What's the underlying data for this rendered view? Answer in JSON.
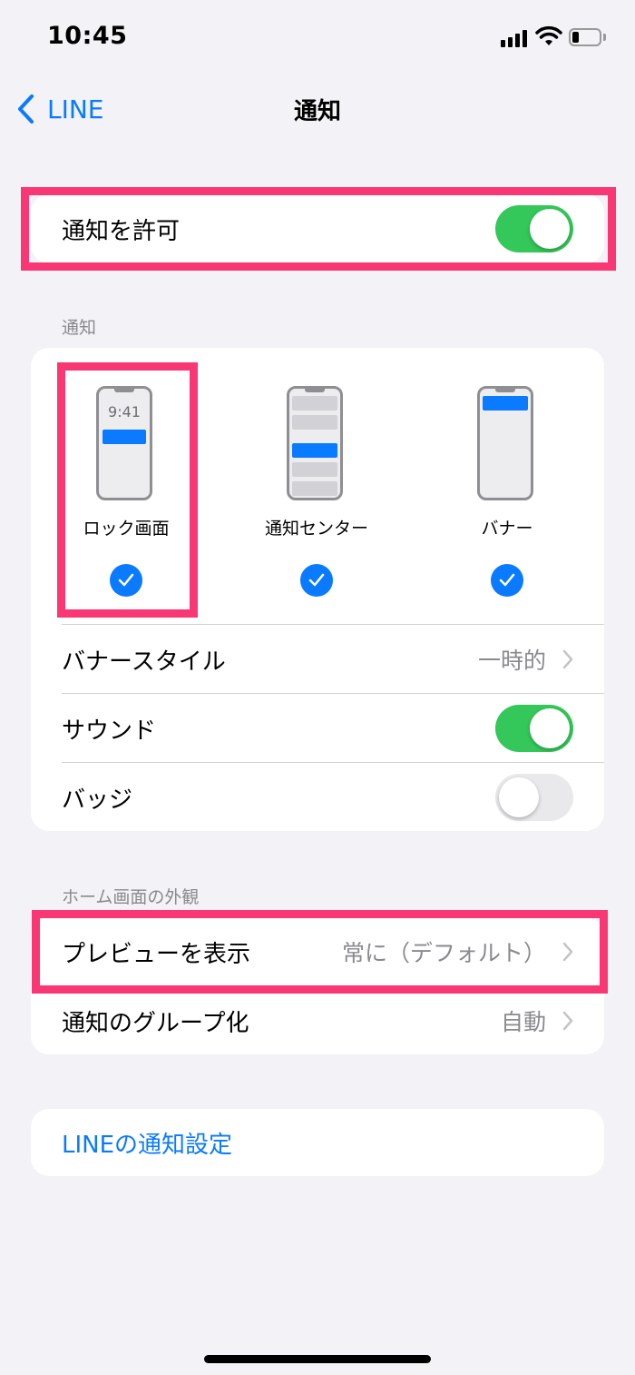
{
  "status_bar": {
    "time": "10:45"
  },
  "nav": {
    "back_label": "LINE",
    "title": "通知"
  },
  "allow": {
    "label": "通知を許可",
    "enabled": true
  },
  "notifications_section": {
    "header": "通知",
    "styles": [
      {
        "label": "ロック画面",
        "preview_time": "9:41",
        "checked": true
      },
      {
        "label": "通知センター",
        "checked": true
      },
      {
        "label": "バナー",
        "checked": true
      }
    ],
    "banner_style": {
      "label": "バナースタイル",
      "value": "一時的"
    },
    "sound": {
      "label": "サウンド",
      "enabled": true
    },
    "badges": {
      "label": "バッジ",
      "enabled": false
    }
  },
  "home_section": {
    "header": "ホーム画面の外観",
    "show_previews": {
      "label": "プレビューを表示",
      "value": "常に（デフォルト）"
    },
    "grouping": {
      "label": "通知のグループ化",
      "value": "自動"
    }
  },
  "line_settings": {
    "label": "LINEの通知設定"
  },
  "colors": {
    "accent": "#0a7aff",
    "toggle_on": "#34c759",
    "highlight": "#f83774",
    "background": "#f2f2f7"
  }
}
